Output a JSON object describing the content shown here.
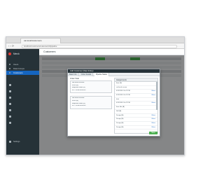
{
  "browser": {
    "tab_title": "cat.local/customers",
    "url": "localhost/customers/customer/c0/pipeline",
    "nav": "‹ › ⟳"
  },
  "sidebar": {
    "app_name": "Merck",
    "items": [
      {
        "label": "Users"
      },
      {
        "label": "Data Groups"
      },
      {
        "label": "Customers"
      }
    ],
    "footer": "Settings"
  },
  "main": {
    "title": "Customers"
  },
  "modal": {
    "title": "Add Customer (New Entry)",
    "tabs": [
      "Basic Info",
      "Order Details",
      "Pipeline Status"
    ],
    "left_sections": [
      {
        "label": "Order Total",
        "lines": [
          "cat.local.co/order",
          "Point (A)",
          "Required Field (A)",
          "FHT 2019-09-2034"
        ]
      },
      {
        "label": "",
        "lines": [
          "cat.local.co/order",
          "Point (B)",
          "Required Field (B)",
          "FHT 2019-09-2034"
        ]
      }
    ],
    "right_header": "Assignments",
    "right_rows": [
      {
        "text": "Item title",
        "action": ""
      },
      {
        "text": "cat.local.co.mm",
        "action": ""
      },
      {
        "text": "4/15/2019 10:47 PM",
        "action": "Move"
      },
      {
        "text": "4/15/2019 10:47 PM",
        "action": "Move"
      },
      {
        "text": "item",
        "action": ""
      },
      {
        "text": "4/15/2019 10:47 PM",
        "action": "Move"
      },
      {
        "text": "Item title (A)",
        "action": ""
      },
      {
        "text": "Sell (A)",
        "action": ""
      },
      {
        "text": "Design (A)",
        "action": "Move"
      },
      {
        "text": "Design (A)",
        "action": "Move"
      },
      {
        "text": "Design (A)",
        "action": "Move"
      },
      {
        "text": "Design (A)",
        "action": "Move"
      }
    ],
    "save_label": "Save"
  },
  "colors": {
    "sidebar_bg": "#263238",
    "accent": "#1565c0",
    "success": "#4caf50"
  }
}
